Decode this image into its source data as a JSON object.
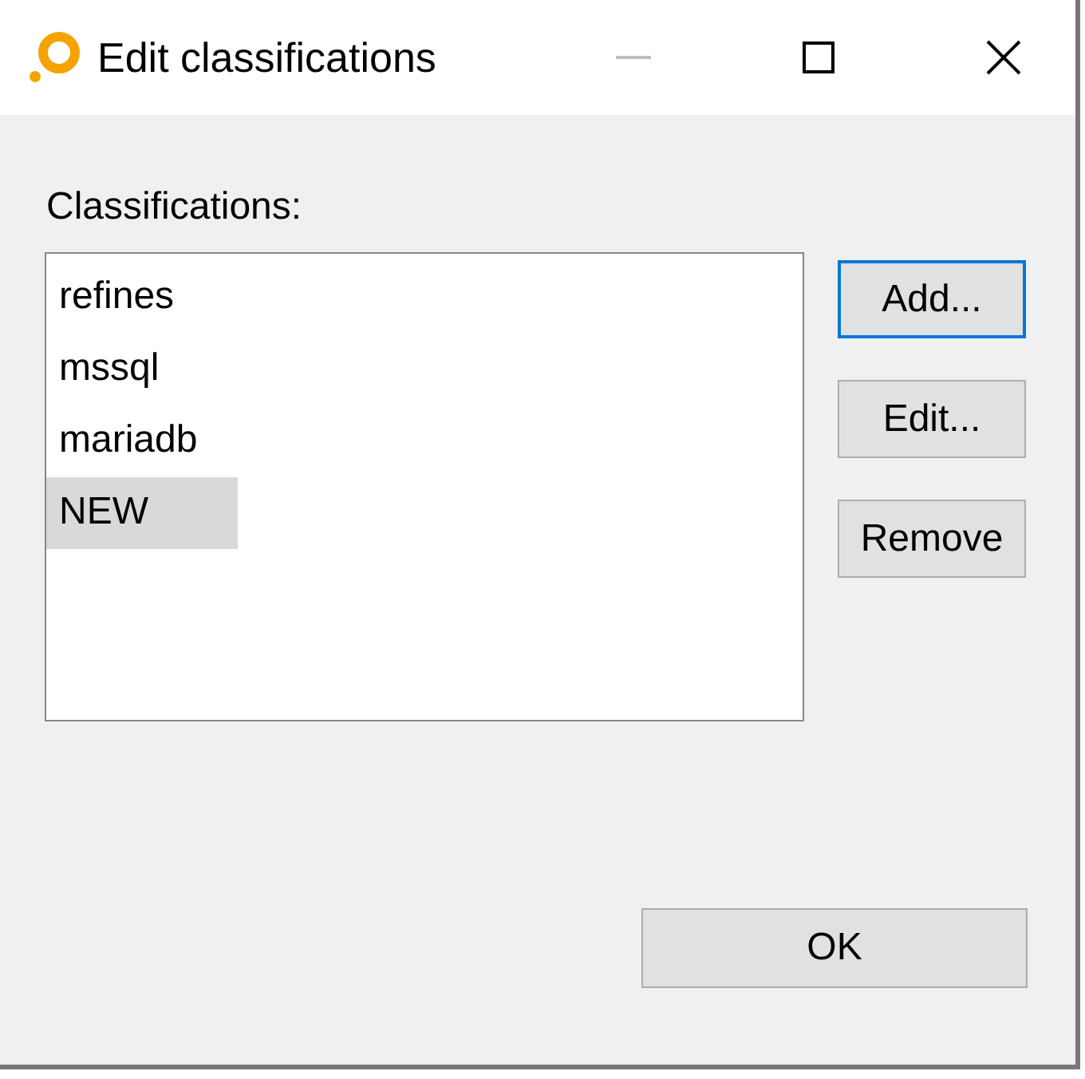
{
  "window": {
    "title": "Edit classifications",
    "minimize_disabled": true
  },
  "label": "Classifications:",
  "items": [
    {
      "text": "refines",
      "selected": false
    },
    {
      "text": "mssql",
      "selected": false
    },
    {
      "text": "mariadb",
      "selected": false
    },
    {
      "text": "NEW",
      "selected": true
    }
  ],
  "side_buttons": [
    {
      "label": "Add...",
      "focused": true
    },
    {
      "label": "Edit...",
      "focused": false
    },
    {
      "label": "Remove",
      "focused": false
    }
  ],
  "ok_button": "OK"
}
